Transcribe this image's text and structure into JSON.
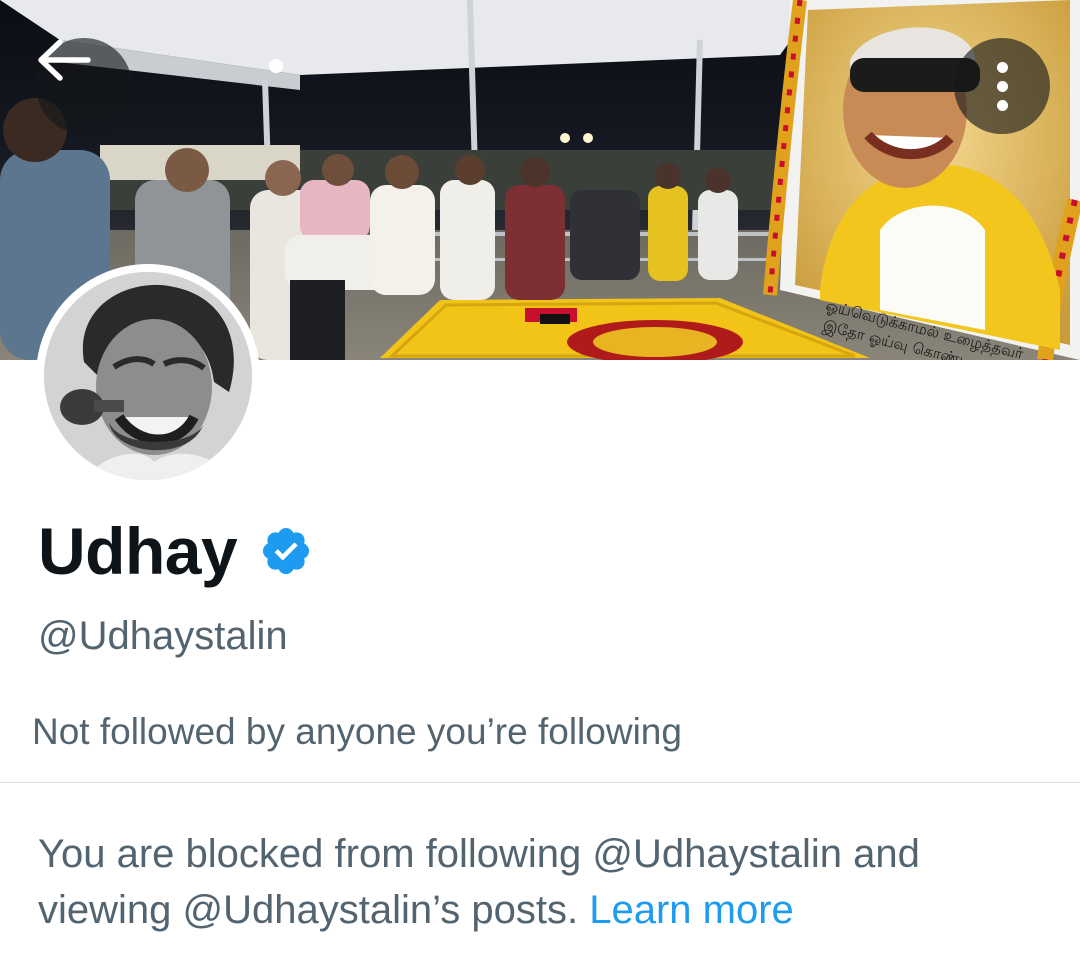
{
  "header": {
    "back_icon": "arrow-left-icon",
    "more_icon": "more-vertical-icon"
  },
  "banner": {
    "portrait_caption_line1": "ஓய்வெடுக்காமல் உழைத்தவர்",
    "portrait_caption_line2": "இதோ ஓய்வு கொண்டிருக்கிறார்",
    "accent_yellow": "#f5c518",
    "accent_red": "#c8102e"
  },
  "profile": {
    "display_name": "Udhay",
    "verified_icon": "verified-badge-icon",
    "verified_color": "#1d9bf0",
    "handle": "@Udhaystalin",
    "followers_note": "Not followed by anyone you’re following"
  },
  "blocked": {
    "message": "You are blocked from following @Udhaystalin and viewing @Udhaystalin’s posts.",
    "learn_more": "Learn more",
    "link_color": "#1d9bf0"
  }
}
